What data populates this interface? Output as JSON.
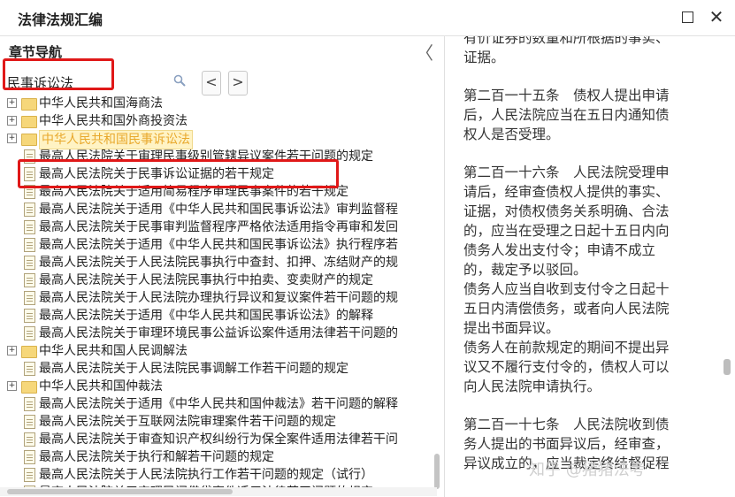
{
  "window": {
    "title": "法律法规汇编"
  },
  "nav": {
    "title": "章节导航",
    "collapse_icon": "chevron-left-icon",
    "search_value": "民事诉讼法",
    "prev_label": "<",
    "next_label": ">"
  },
  "tree": [
    {
      "type": "folder",
      "expander": "+",
      "label": "中华人民共和国海商法"
    },
    {
      "type": "folder",
      "expander": "+",
      "label": "中华人民共和国外商投资法"
    },
    {
      "type": "folder",
      "expander": "+",
      "label": "中华人民共和国民事诉讼法",
      "selected": true
    },
    {
      "type": "doc",
      "label": "最高人民法院关于审理民事级别管辖异议案件若干问题的规定"
    },
    {
      "type": "doc",
      "label": "最高人民法院关于民事诉讼证据的若干规定",
      "highlighted": true
    },
    {
      "type": "doc",
      "label": "最高人民法院关于适用简易程序审理民事案件的若干规定"
    },
    {
      "type": "doc",
      "label": "最高人民法院关于适用《中华人民共和国民事诉讼法》审判监督程"
    },
    {
      "type": "doc",
      "label": "最高人民法院关于民事审判监督程序严格依法适用指令再审和发回"
    },
    {
      "type": "doc",
      "label": "最高人民法院关于适用《中华人民共和国民事诉讼法》执行程序若"
    },
    {
      "type": "doc",
      "label": "最高人民法院关于人民法院民事执行中查封、扣押、冻结财产的规"
    },
    {
      "type": "doc",
      "label": "最高人民法院关于人民法院民事执行中拍卖、变卖财产的规定"
    },
    {
      "type": "doc",
      "label": "最高人民法院关于人民法院办理执行异议和复议案件若干问题的规"
    },
    {
      "type": "doc",
      "label": "最高人民法院关于适用《中华人民共和国民事诉讼法》的解释"
    },
    {
      "type": "doc",
      "label": "最高人民法院关于审理环境民事公益诉讼案件适用法律若干问题的"
    },
    {
      "type": "folder",
      "expander": "+",
      "label": "中华人民共和国人民调解法"
    },
    {
      "type": "doc",
      "label": "最高人民法院关于人民法院民事调解工作若干问题的规定"
    },
    {
      "type": "folder",
      "expander": "+",
      "label": "中华人民共和国仲裁法"
    },
    {
      "type": "doc",
      "label": "最高人民法院关于适用《中华人民共和国仲裁法》若干问题的解释"
    },
    {
      "type": "doc",
      "label": "最高人民法院关于互联网法院审理案件若干问题的规定"
    },
    {
      "type": "doc",
      "label": "最高人民法院关于审查知识产权纠纷行为保全案件适用法律若干问"
    },
    {
      "type": "doc",
      "label": "最高人民法院关于执行和解若干问题的规定"
    },
    {
      "type": "doc",
      "label": "最高人民法院关于人民法院执行工作若干问题的规定（试行）"
    },
    {
      "type": "doc",
      "label": "最高人民法院关于审理民间借贷案件适用法律若干问题的规定"
    }
  ],
  "content": {
    "blocks": [
      {
        "lines": [
          "有价证券的数量和所根据的事实、",
          "证据。"
        ]
      },
      {
        "lines": [
          "第二百一十五条　债权人提出申请",
          "后，人民法院应当在五日内通知债",
          "权人是否受理。"
        ]
      },
      {
        "lines": [
          "第二百一十六条　人民法院受理申",
          "请后，经审查债权人提供的事实、",
          "证据，对债权债务关系明确、合法",
          "的，应当在受理之日起十五日内向",
          "债务人发出支付令；申请不成立",
          "的，裁定予以驳回。",
          "债务人应当自收到支付令之日起十",
          "五日内清偿债务，或者向人民法院",
          "提出书面异议。",
          "债务人在前款规定的期间不提出异",
          "议又不履行支付令的，债权人可以",
          "向人民法院申请执行。"
        ]
      },
      {
        "lines": [
          "第二百一十七条　人民法院收到债",
          "务人提出的书面异议后，经审查，",
          "异议成立的，应当裁定终结督促程"
        ]
      }
    ],
    "watermark": "知乎 @猪猪法考"
  },
  "colors": {
    "highlight_red": "#e01818",
    "folder": "#f6d77a",
    "selected_text": "#e8a82c"
  }
}
